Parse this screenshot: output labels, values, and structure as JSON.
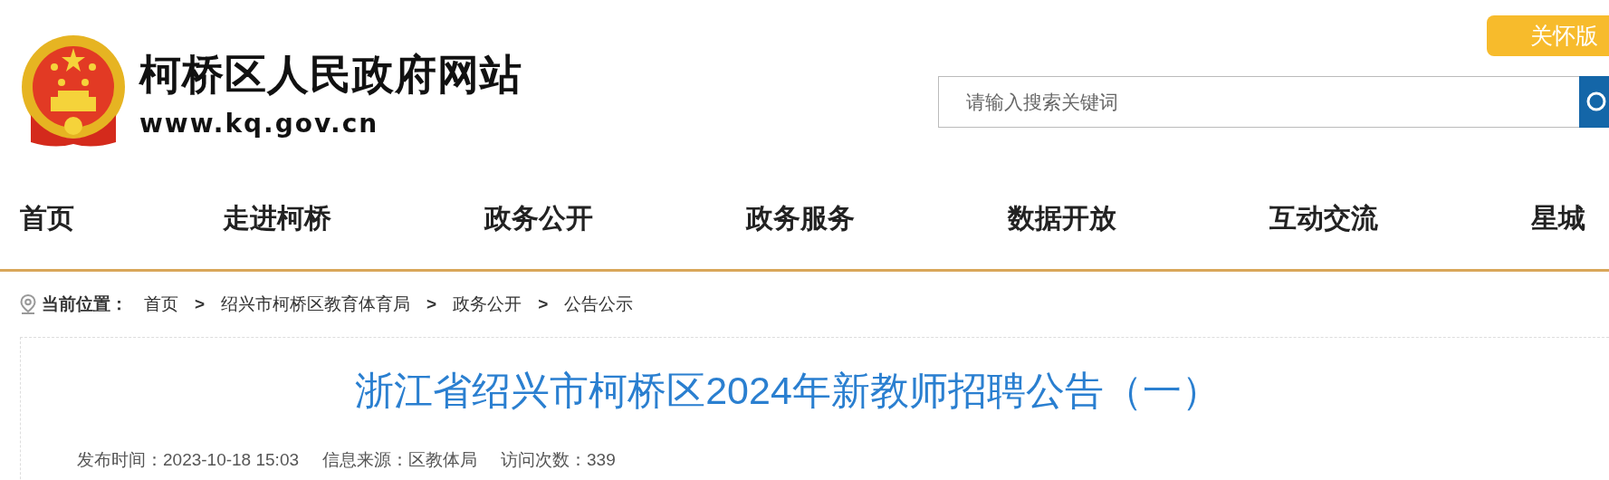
{
  "header": {
    "site_title": "柯桥区人民政府网站",
    "site_url": "www.kq.gov.cn",
    "care_mode_button": "关怀版",
    "search": {
      "placeholder": "请输入搜索关键词"
    }
  },
  "nav": [
    {
      "label": "首页"
    },
    {
      "label": "走进柯桥"
    },
    {
      "label": "政务公开"
    },
    {
      "label": "政务服务"
    },
    {
      "label": "数据开放"
    },
    {
      "label": "互动交流"
    },
    {
      "label": "星城"
    }
  ],
  "breadcrumb": {
    "label": "当前位置：",
    "items": [
      "首页",
      "绍兴市柯桥区教育体育局",
      "政务公开",
      "公告公示"
    ],
    "separator": ">"
  },
  "article": {
    "title": "浙江省绍兴市柯桥区2024年新教师招聘公告（一）",
    "meta": [
      "发布时间：2023-10-18 15:03",
      "信息来源：区教体局",
      "访问次数：339"
    ]
  }
}
